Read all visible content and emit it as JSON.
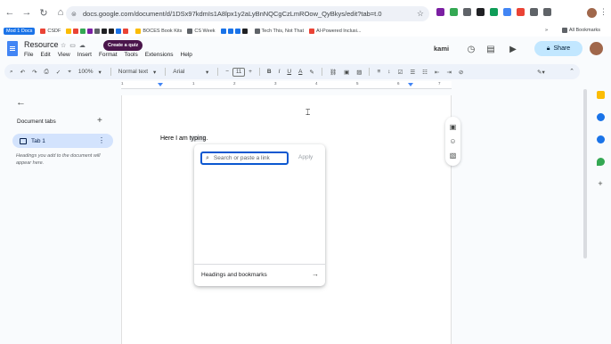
{
  "browser": {
    "url": "docs.google.com/document/d/1DSx97kdmIs1A8lpx1y2aLyBnNQCgCzLmROow_QyBkys/edit?tab=t.0",
    "nav": {
      "back": "←",
      "forward": "→",
      "reload": "↻",
      "home": "⌂"
    },
    "bookmarks": [
      "Mod 1 Docs",
      "CSDF",
      "BOCES Book Kits",
      "CS Week",
      "Tech This, Not That",
      "AI-Powered Inclusi..."
    ],
    "all_bookmarks": "All Bookmarks",
    "overflow": "»"
  },
  "docs": {
    "title": "Resource",
    "quiz_button": "Create a quiz",
    "menu": [
      "File",
      "Edit",
      "View",
      "Insert",
      "Format",
      "Tools",
      "Extensions",
      "Help"
    ],
    "kami_label": "kami",
    "share_label": "Share"
  },
  "toolbar": {
    "zoom": "100%",
    "style": "Normal text",
    "font": "Arial",
    "font_size": "11",
    "minus": "−",
    "plus": "+",
    "bold": "B",
    "italic": "I",
    "underline": "U",
    "text_color": "A"
  },
  "ruler": {
    "numbers": [
      "1",
      "1",
      "2",
      "3",
      "4",
      "5",
      "6",
      "7"
    ]
  },
  "sidebar": {
    "heading": "Document tabs",
    "add": "+",
    "tab_label": "Tab 1",
    "hint": "Headings you add to the document will appear here."
  },
  "document": {
    "text_before": "Here I am ",
    "text_selected": "typing",
    "text_after": "."
  },
  "link_popup": {
    "placeholder": "Search or paste a link",
    "apply": "Apply",
    "headings_bookmarks": "Headings and bookmarks",
    "arrow": "→"
  },
  "colors": {
    "accent": "#0b57d0",
    "share_bg": "#c2e7ff",
    "tab_active": "#d3e3fd",
    "docs_blue": "#4285f4"
  }
}
